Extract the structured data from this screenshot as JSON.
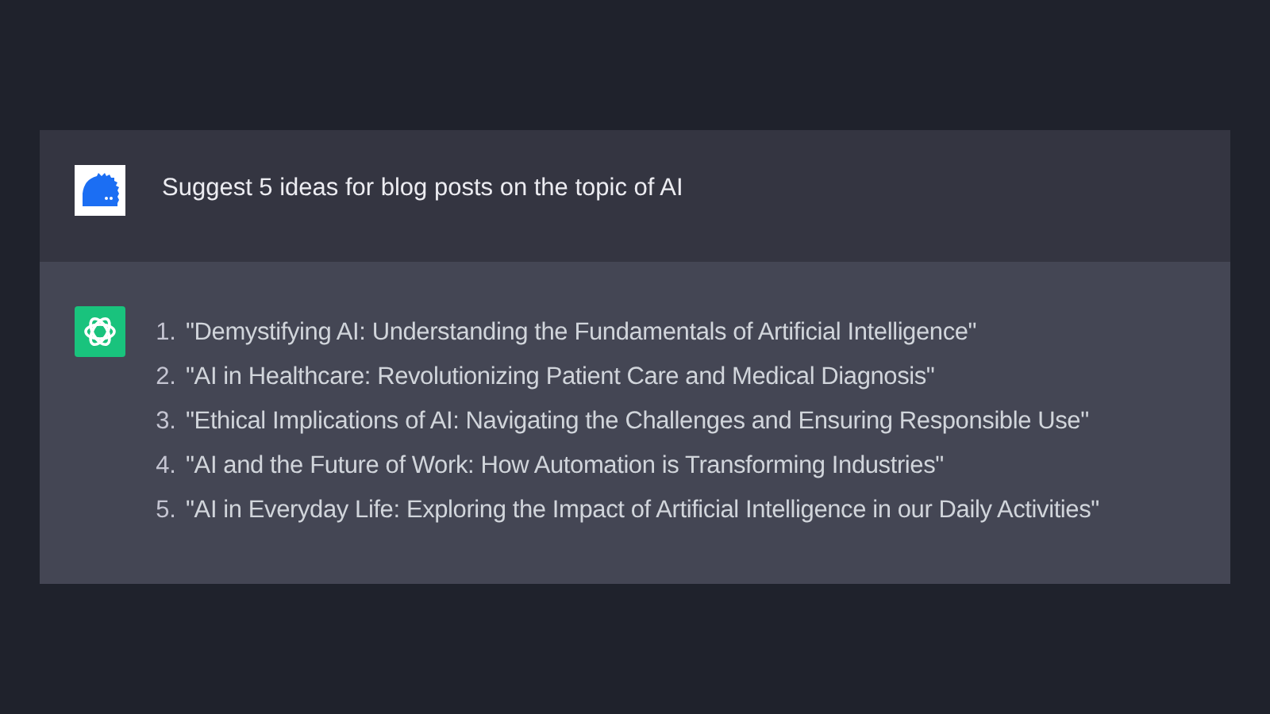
{
  "messages": [
    {
      "kind": "user",
      "text": "Suggest 5 ideas for blog posts on the topic of AI"
    },
    {
      "kind": "assistant",
      "items": [
        {
          "number": "1.",
          "text": "\"Demystifying AI: Understanding the Fundamentals of Artificial Intelligence\""
        },
        {
          "number": "2.",
          "text": "\"AI in Healthcare: Revolutionizing Patient Care and Medical Diagnosis\""
        },
        {
          "number": "3.",
          "text": "\"Ethical Implications of AI: Navigating the Challenges and Ensuring Responsible Use\""
        },
        {
          "number": "4.",
          "text": "\"AI and the Future of Work: How Automation is Transforming Industries\""
        },
        {
          "number": "5.",
          "text": "\"AI in Everyday Life: Exploring the Impact of Artificial Intelligence in our Daily Activities\""
        }
      ]
    }
  ]
}
